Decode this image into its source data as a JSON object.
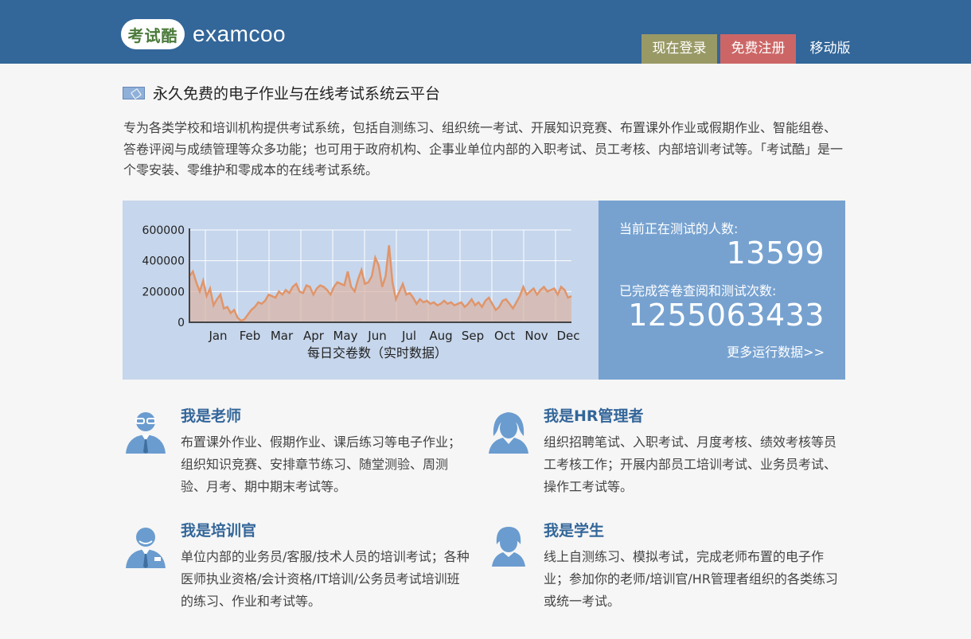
{
  "header": {
    "logo_badge": "考试酷",
    "logo_text": "examcoo",
    "nav": {
      "login": "现在登录",
      "register": "免费注册",
      "mobile": "移动版"
    },
    "colors": {
      "bar": "#336699",
      "login": "#999966",
      "register": "#cc6666"
    }
  },
  "main": {
    "title": "永久免费的电子作业与在线考试系统云平台",
    "intro": "专为各类学校和培训机构提供考试系统，包括自测练习、组织统一考试、开展知识竞赛、布置课外作业或假期作业、智能组卷、答卷评阅与成绩管理等众多功能；也可用于政府机构、企事业单位内部的入职考试、员工考核、内部培训考试等。「考试酷」是一个零安装、零维护和零成本的在线考试系统。"
  },
  "stats": {
    "testing_label": "当前正在测试的人数:",
    "testing_value": "13599",
    "completed_label": "已完成答卷查阅和测试次数:",
    "completed_value": "1255063433",
    "more_link": "更多运行数据>>"
  },
  "chart_data": {
    "type": "area",
    "xlabel": "每日交卷数（实时数据）",
    "ylim": [
      0,
      600000
    ],
    "yticks": [
      "0",
      "200000",
      "400000",
      "600000"
    ],
    "months": [
      "Jan",
      "Feb",
      "Mar",
      "Apr",
      "May",
      "Jun",
      "Jul",
      "Aug",
      "Sep",
      "Oct",
      "Nov",
      "Dec"
    ],
    "grid": true,
    "color": "#e0956a",
    "values": [
      300000,
      330000,
      260000,
      200000,
      270000,
      170000,
      220000,
      110000,
      150000,
      180000,
      90000,
      100000,
      60000,
      80000,
      30000,
      10000,
      20000,
      50000,
      80000,
      100000,
      130000,
      120000,
      140000,
      180000,
      170000,
      160000,
      200000,
      180000,
      210000,
      190000,
      230000,
      250000,
      200000,
      190000,
      240000,
      230000,
      180000,
      220000,
      240000,
      230000,
      210000,
      180000,
      230000,
      260000,
      250000,
      240000,
      330000,
      230000,
      200000,
      280000,
      340000,
      250000,
      260000,
      300000,
      420000,
      370000,
      230000,
      300000,
      500000,
      260000,
      150000,
      200000,
      250000,
      180000,
      190000,
      160000,
      120000,
      150000,
      130000,
      140000,
      120000,
      130000,
      110000,
      120000,
      140000,
      120000,
      130000,
      110000,
      120000,
      130000,
      100000,
      120000,
      150000,
      110000,
      130000,
      100000,
      140000,
      160000,
      120000,
      80000,
      100000,
      140000,
      150000,
      120000,
      90000,
      130000,
      170000,
      230000,
      180000,
      200000,
      220000,
      180000,
      210000,
      230000,
      200000,
      210000,
      220000,
      180000,
      230000,
      210000,
      160000,
      170000
    ]
  },
  "cards": [
    {
      "title": "我是老师",
      "desc": "布置课外作业、假期作业、课后练习等电子作业；组织知识竞赛、安排章节练习、随堂测验、周测验、月考、期中期末考试等。",
      "icon": "teacher-icon"
    },
    {
      "title": "我是HR管理者",
      "desc": "组织招聘笔试、入职考试、月度考核、绩效考核等员工考核工作；开展内部员工培训考试、业务员考试、操作工考试等。",
      "icon": "hr-manager-icon"
    },
    {
      "title": "我是培训官",
      "desc": "单位内部的业务员/客服/技术人员的培训考试；各种医师执业资格/会计资格/IT培训/公务员考试培训班的练习、作业和考试等。",
      "icon": "trainer-icon"
    },
    {
      "title": "我是学生",
      "desc": "线上自测练习、模拟考试，完成老师布置的电子作业；参加你的老师/培训官/HR管理者组织的各类练习或统一考试。",
      "icon": "student-icon"
    }
  ]
}
